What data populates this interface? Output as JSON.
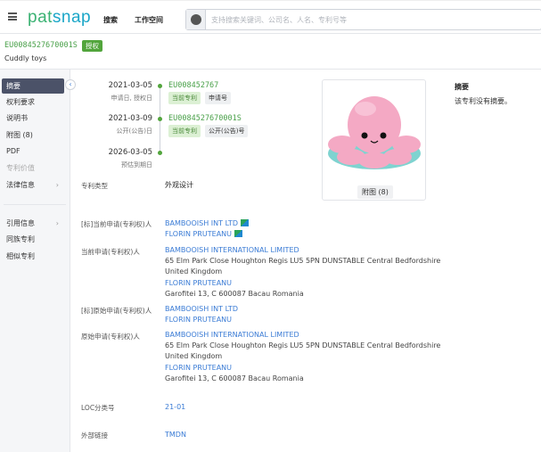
{
  "header": {
    "logo": "patsnap",
    "nav": [
      "搜索",
      "工作空间"
    ],
    "search_placeholder": "支持搜索关键词、公司名、人名、专利号等"
  },
  "patent": {
    "number": "EU008452767000​1S",
    "status_badge": "授权",
    "title": "Cuddly toys"
  },
  "sidebar": {
    "items": [
      {
        "label": "摘要",
        "active": true
      },
      {
        "label": "权利要求"
      },
      {
        "label": "说明书"
      },
      {
        "label": "附图 (8)"
      },
      {
        "label": "PDF"
      },
      {
        "label": "专利价值",
        "disabled": true
      },
      {
        "label": "法律信息",
        "chevron": "›"
      },
      {
        "label": "引用信息",
        "chevron": "›"
      },
      {
        "label": "同族专利"
      },
      {
        "label": "相似专利"
      }
    ],
    "collapse_icon": "‹"
  },
  "timeline": [
    {
      "date": "2021-03-05",
      "label": "申请日, 授权日",
      "code": "EU008452767",
      "tags": [
        "当前专利",
        "申请号"
      ]
    },
    {
      "date": "2021-03-09",
      "label": "公开(公告)日",
      "code": "EU0084527670001S",
      "tags": [
        "当前专利",
        "公开(公告)号"
      ]
    },
    {
      "date": "2026-03-05",
      "label": "预估到期日"
    }
  ],
  "fields": {
    "type": {
      "label": "专利类型",
      "value": "外观设计"
    },
    "std_current": {
      "label": "[标]当前申请(专利权)人",
      "names": [
        "BAMBOOISH INT LTD",
        "FLORIN PRUTEANU"
      ]
    },
    "current": {
      "label": "当前申请(专利权)人",
      "name1": "BAMBOOISH INTERNATIONAL LIMITED",
      "addr1a": "65 Elm Park Close Houghton Regis LU5 5PN DUNSTABLE Central Bedfordshire",
      "addr1b": "United Kingdom",
      "name2": "FLORIN PRUTEANU",
      "addr2": "Garofitei 13, C 600087 Bacau Romania"
    },
    "std_original": {
      "label": "[标]原始申请(专利权)人",
      "names": [
        "BAMBOOISH INT LTD",
        "FLORIN PRUTEANU"
      ]
    },
    "original": {
      "label": "原始申请(专利权)人",
      "name1": "BAMBOOISH INTERNATIONAL LIMITED",
      "addr1a": "65 Elm Park Close Houghton Regis LU5 5PN DUNSTABLE Central Bedfordshire",
      "addr1b": "United Kingdom",
      "name2": "FLORIN PRUTEANU",
      "addr2": "Garofitei 13, C 600087 Bacau Romania"
    },
    "loc": {
      "label": "LOC分类号",
      "value": "21-01"
    },
    "external": {
      "label": "外部链接",
      "value": "TMDN"
    }
  },
  "image": {
    "button": "附图 (8)"
  },
  "abstract": {
    "heading": "摘要",
    "text": "该专利没有摘要。"
  }
}
